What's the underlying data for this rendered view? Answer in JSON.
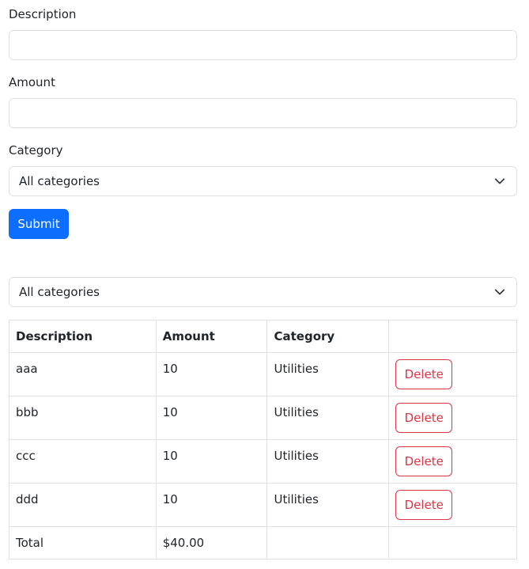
{
  "form": {
    "description_label": "Description",
    "description_value": "",
    "amount_label": "Amount",
    "amount_value": "",
    "category_label": "Category",
    "category_selected": "All categories",
    "submit_label": "Submit"
  },
  "filter": {
    "selected": "All categories"
  },
  "table": {
    "headers": [
      "Description",
      "Amount",
      "Category",
      ""
    ],
    "rows": [
      {
        "description": "aaa",
        "amount": "10",
        "category": "Utilities",
        "action": "Delete"
      },
      {
        "description": "bbb",
        "amount": "10",
        "category": "Utilities",
        "action": "Delete"
      },
      {
        "description": "ccc",
        "amount": "10",
        "category": "Utilities",
        "action": "Delete"
      },
      {
        "description": "ddd",
        "amount": "10",
        "category": "Utilities",
        "action": "Delete"
      }
    ],
    "total_label": "Total",
    "total_value": "$40.00"
  },
  "icons": {
    "select_arrow": "chevron-down-icon"
  },
  "colors": {
    "primary": "#0d6efd",
    "danger": "#dc3545",
    "border": "#dee2e6",
    "text": "#212529"
  }
}
